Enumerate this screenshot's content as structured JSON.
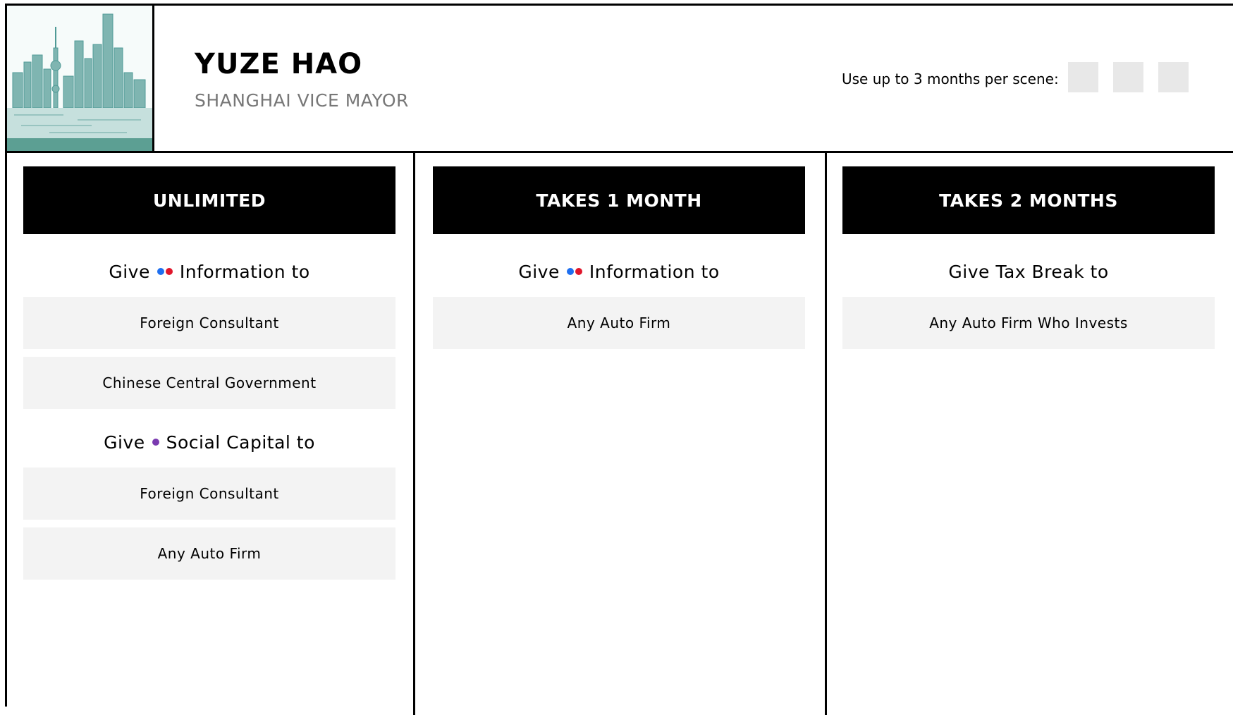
{
  "character": {
    "name": "YUZE HAO",
    "role": "SHANGHAI VICE MAYOR"
  },
  "months": {
    "label": "Use up to 3 months per scene:",
    "slots": 3
  },
  "colors": {
    "blue_dot": "#1e6ff0",
    "red_dot": "#e0162b",
    "purple_dot": "#7a3ab0",
    "city_tint": "#4f9a96"
  },
  "columns": [
    {
      "header": "UNLIMITED",
      "sections": [
        {
          "before": "Give",
          "dots": [
            "blue",
            "red"
          ],
          "after": "Information to",
          "options": [
            "Foreign Consultant",
            "Chinese Central Government"
          ]
        },
        {
          "before": "Give",
          "dots": [
            "purple"
          ],
          "after": "Social Capital to",
          "options": [
            "Foreign Consultant",
            "Any Auto Firm"
          ]
        }
      ]
    },
    {
      "header": "TAKES 1 MONTH",
      "sections": [
        {
          "before": "Give",
          "dots": [
            "blue",
            "red"
          ],
          "after": "Information to",
          "options": [
            "Any Auto Firm"
          ]
        }
      ]
    },
    {
      "header": "TAKES 2 MONTHS",
      "sections": [
        {
          "before": "Give Tax Break to",
          "dots": [],
          "after": "",
          "options": [
            "Any Auto Firm Who Invests"
          ]
        }
      ]
    }
  ]
}
